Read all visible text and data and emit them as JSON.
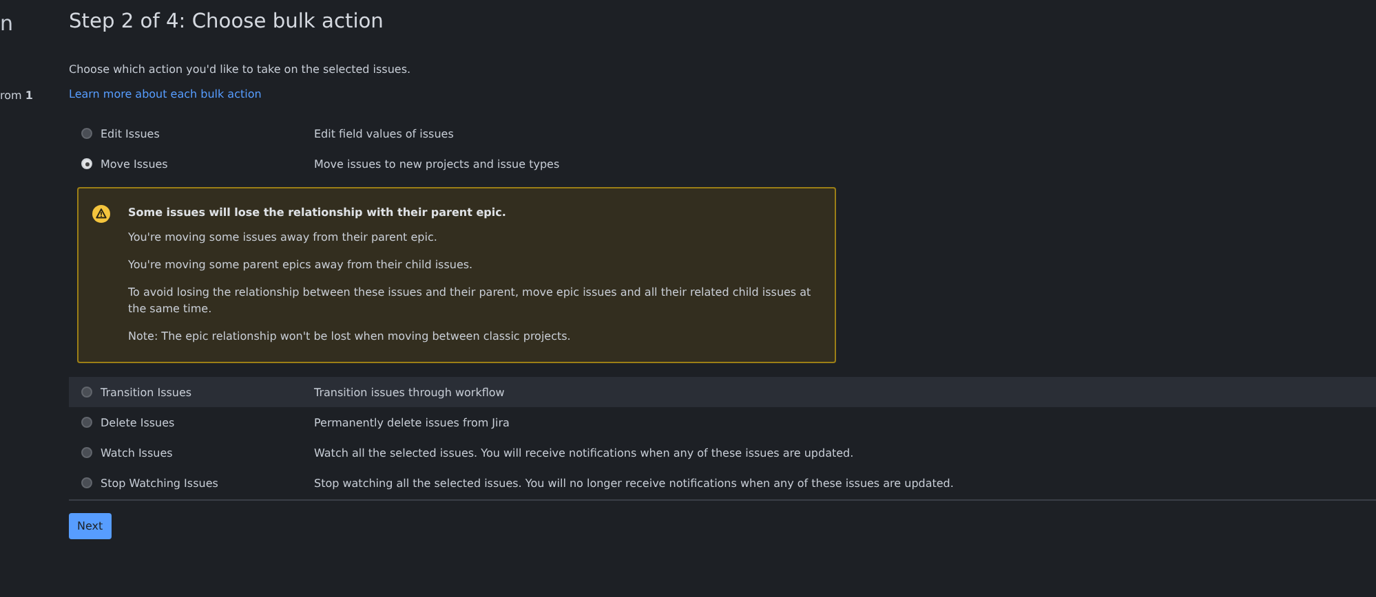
{
  "sidebar": {
    "items": [
      "n",
      "rom **1**"
    ]
  },
  "title": "Step 2 of 4: Choose bulk action",
  "intro": "Choose which action you'd like to take on the selected issues.",
  "help_link": "Learn more about each bulk action",
  "options": [
    {
      "kind": "option",
      "label": "Edit Issues",
      "description": "Edit field values of issues",
      "selected": false,
      "highlighted": false
    },
    {
      "kind": "option",
      "label": "Move Issues",
      "description": "Move issues to new projects and issue types",
      "selected": true,
      "highlighted": false
    },
    {
      "kind": "warning",
      "title": "Some issues will lose the relationship with their parent epic.",
      "paragraphs": [
        "You're moving some issues away from their parent epic.",
        "You're moving some parent epics away from their child issues.",
        "To avoid losing the relationship between these issues and their parent, move epic issues and all their related child issues at the same time.",
        "Note: The epic relationship won't be lost when moving between classic projects."
      ]
    },
    {
      "kind": "option",
      "label": "Transition Issues",
      "description": "Transition issues through workflow",
      "selected": false,
      "highlighted": true
    },
    {
      "kind": "option",
      "label": "Delete Issues",
      "description": "Permanently delete issues from Jira",
      "selected": false,
      "highlighted": false
    },
    {
      "kind": "option",
      "label": "Watch Issues",
      "description": "Watch all the selected issues. You will receive notifications when any of these issues are updated.",
      "selected": false,
      "highlighted": false
    },
    {
      "kind": "option",
      "label": "Stop Watching Issues",
      "description": "Stop watching all the selected issues. You will no longer receive notifications when any of these issues are updated.",
      "selected": false,
      "highlighted": false
    }
  ],
  "button": "Next"
}
